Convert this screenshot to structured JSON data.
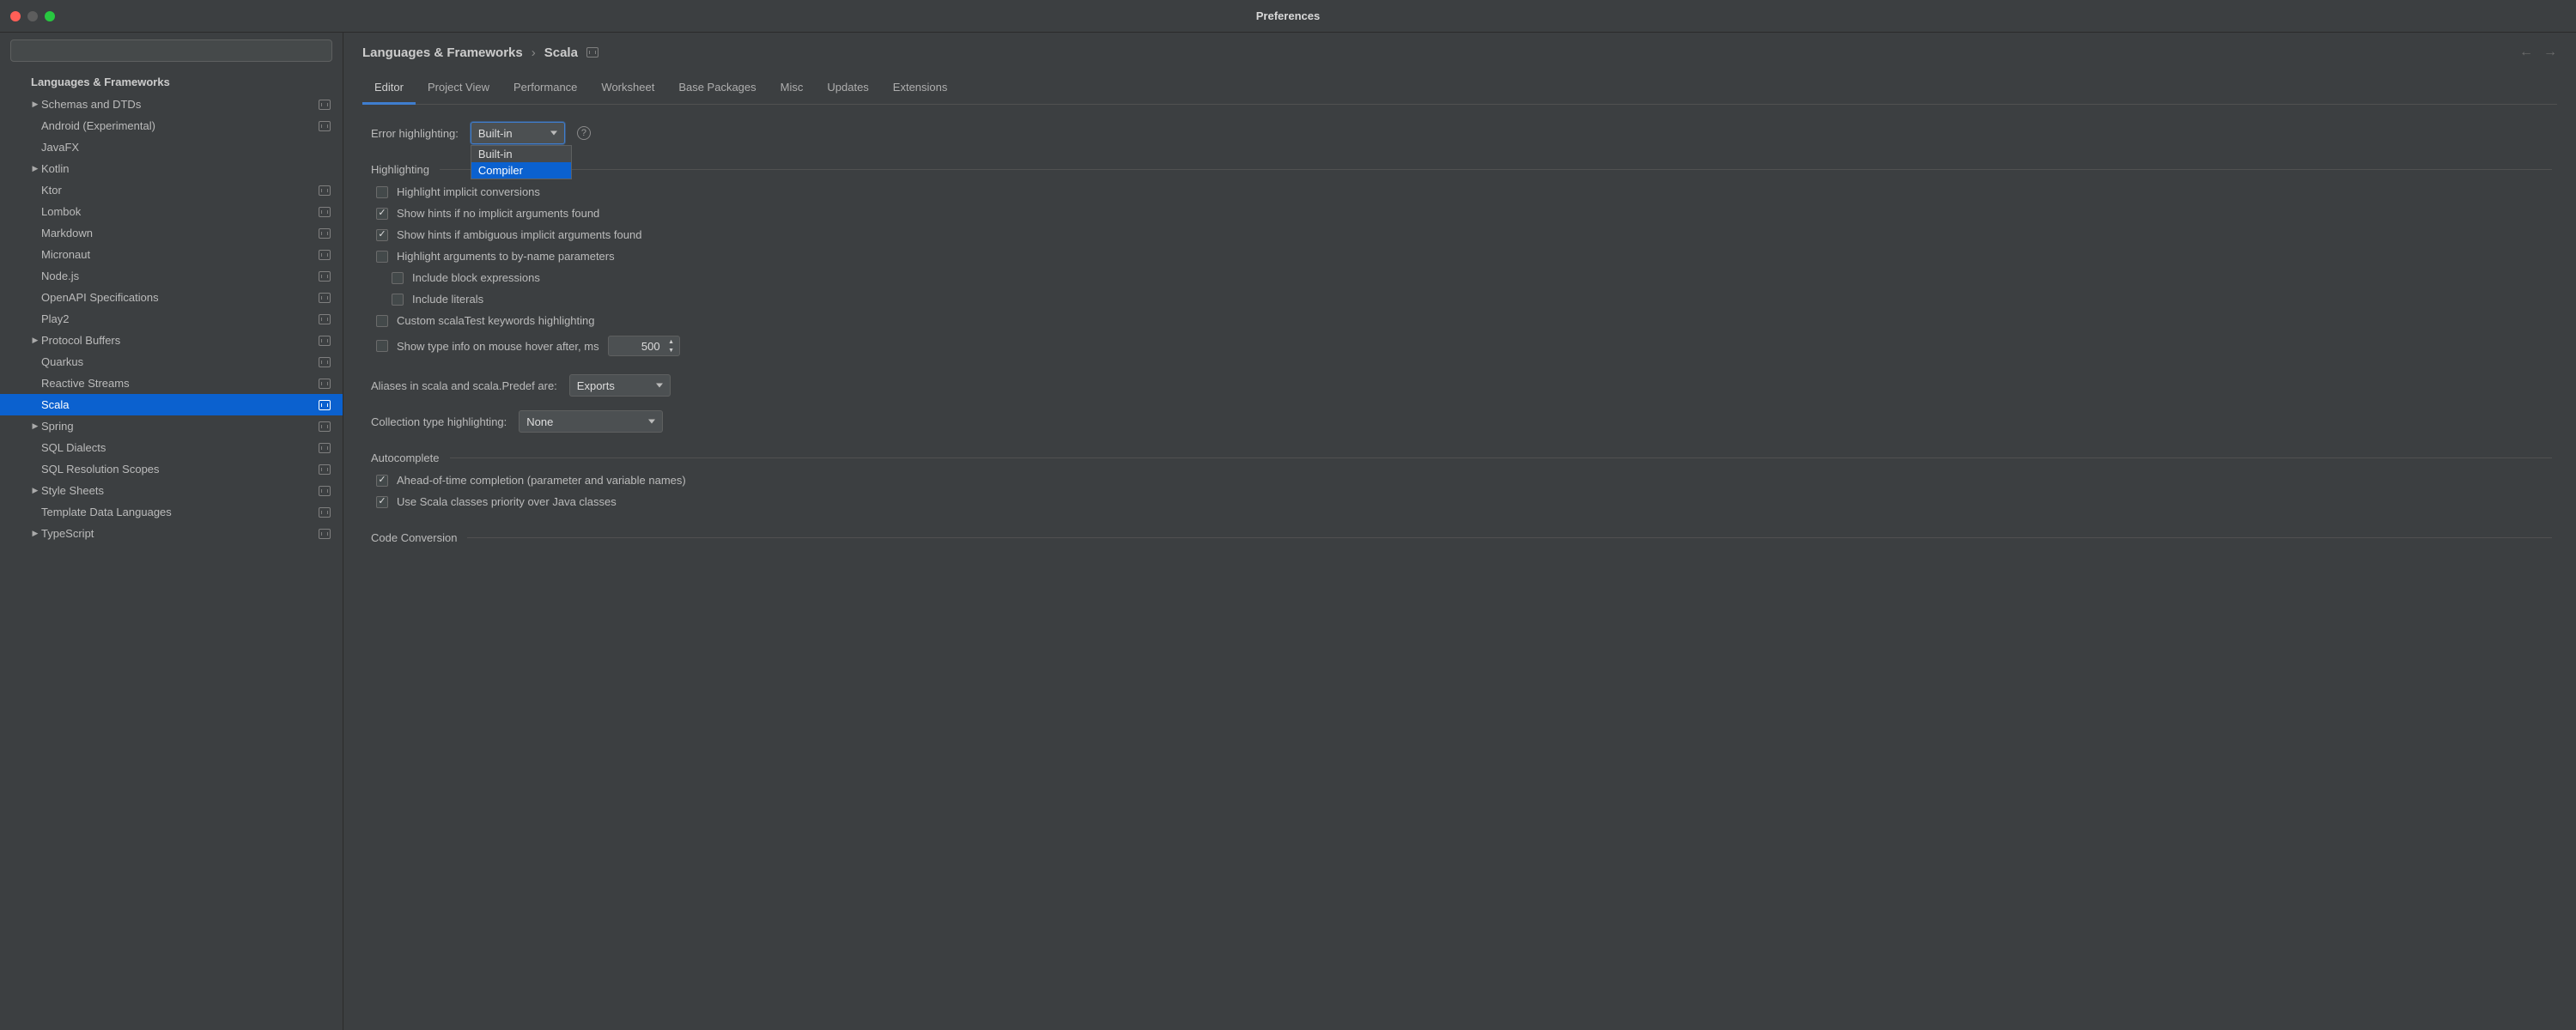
{
  "window": {
    "title": "Preferences"
  },
  "search": {
    "placeholder": ""
  },
  "sidebar": {
    "section": "Languages & Frameworks",
    "items": [
      {
        "label": "Schemas and DTDs",
        "expandable": true,
        "badge": true
      },
      {
        "label": "Android (Experimental)",
        "expandable": false,
        "badge": true
      },
      {
        "label": "JavaFX",
        "expandable": false,
        "badge": false
      },
      {
        "label": "Kotlin",
        "expandable": true,
        "badge": false
      },
      {
        "label": "Ktor",
        "expandable": false,
        "badge": true
      },
      {
        "label": "Lombok",
        "expandable": false,
        "badge": true
      },
      {
        "label": "Markdown",
        "expandable": false,
        "badge": true
      },
      {
        "label": "Micronaut",
        "expandable": false,
        "badge": true
      },
      {
        "label": "Node.js",
        "expandable": false,
        "badge": true
      },
      {
        "label": "OpenAPI Specifications",
        "expandable": false,
        "badge": true
      },
      {
        "label": "Play2",
        "expandable": false,
        "badge": true
      },
      {
        "label": "Protocol Buffers",
        "expandable": true,
        "badge": true
      },
      {
        "label": "Quarkus",
        "expandable": false,
        "badge": true
      },
      {
        "label": "Reactive Streams",
        "expandable": false,
        "badge": true
      },
      {
        "label": "Scala",
        "expandable": false,
        "badge": true,
        "selected": true
      },
      {
        "label": "Spring",
        "expandable": true,
        "badge": true
      },
      {
        "label": "SQL Dialects",
        "expandable": false,
        "badge": true
      },
      {
        "label": "SQL Resolution Scopes",
        "expandable": false,
        "badge": true
      },
      {
        "label": "Style Sheets",
        "expandable": true,
        "badge": true
      },
      {
        "label": "Template Data Languages",
        "expandable": false,
        "badge": true
      },
      {
        "label": "TypeScript",
        "expandable": true,
        "badge": true
      }
    ]
  },
  "breadcrumb": {
    "root": "Languages & Frameworks",
    "leaf": "Scala"
  },
  "tabs": [
    "Editor",
    "Project View",
    "Performance",
    "Worksheet",
    "Base Packages",
    "Misc",
    "Updates",
    "Extensions"
  ],
  "active_tab": 0,
  "editor": {
    "error_highlighting_label": "Error highlighting:",
    "error_highlighting_value": "Built-in",
    "error_highlighting_options": [
      "Built-in",
      "Compiler"
    ],
    "error_highlighting_highlighted_index": 1,
    "sections": {
      "highlighting": "Highlighting",
      "autocomplete": "Autocomplete",
      "code_conversion": "Code Conversion"
    },
    "checks": {
      "implicit_conversions": {
        "label": "Highlight implicit conversions",
        "checked": false
      },
      "hints_no_implicit": {
        "label": "Show hints if no implicit arguments found",
        "checked": true
      },
      "hints_ambiguous": {
        "label": "Show hints if ambiguous implicit arguments found",
        "checked": true
      },
      "by_name": {
        "label": "Highlight arguments to by-name parameters",
        "checked": false
      },
      "include_block": {
        "label": "Include block expressions",
        "checked": false
      },
      "include_literals": {
        "label": "Include literals",
        "checked": false
      },
      "custom_scalatest": {
        "label": "Custom scalaTest keywords highlighting",
        "checked": false
      },
      "type_hover": {
        "label": "Show type info on mouse hover after, ms",
        "checked": false,
        "value": "500"
      },
      "aot_completion": {
        "label": "Ahead-of-time completion (parameter and variable names)",
        "checked": true
      },
      "scala_priority": {
        "label": "Use Scala classes priority over Java classes",
        "checked": true
      }
    },
    "aliases_label": "Aliases in scala and scala.Predef are:",
    "aliases_value": "Exports",
    "collection_label": "Collection type highlighting:",
    "collection_value": "None"
  }
}
